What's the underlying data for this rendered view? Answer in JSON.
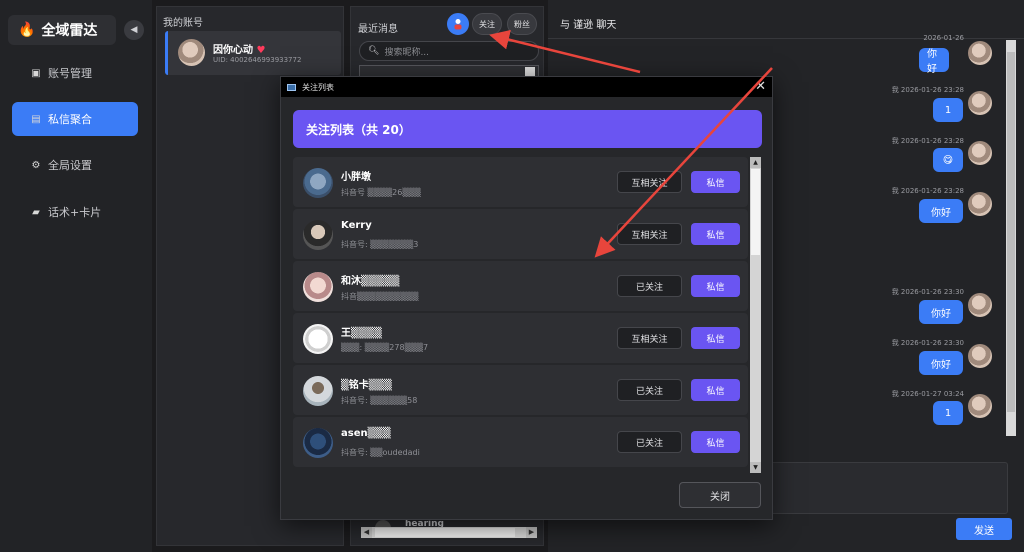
{
  "sidebar": {
    "logo": "全域雷达",
    "collapse_glyph": "◀",
    "items": [
      {
        "label": "账号管理",
        "icon": "id-card-icon",
        "glyph": "▣"
      },
      {
        "label": "私信聚合",
        "icon": "chat-bubble-icon",
        "glyph": "▤"
      },
      {
        "label": "全局设置",
        "icon": "gear-icon",
        "glyph": "⚙"
      },
      {
        "label": "话术+卡片",
        "icon": "folder-icon",
        "glyph": "▰"
      }
    ],
    "active_index": 1
  },
  "accounts": {
    "header": "我的账号",
    "card": {
      "name": "因你心动",
      "heart": "♥",
      "uid": "UID: 4002646993933772"
    }
  },
  "messages": {
    "header": "最近消息",
    "buttons": {
      "follow": "关注",
      "fans": "粉丝"
    },
    "search_placeholder": "搜索昵称...",
    "bottom_item": "hearing"
  },
  "chat": {
    "title": "与 谨逊 聊天",
    "entries": [
      {
        "meta": "2026-01-26",
        "text": "你好"
      },
      {
        "meta": "我  2026-01-26 23:28",
        "text": "1"
      },
      {
        "meta": "我  2026-01-26 23:28",
        "text": "😋"
      },
      {
        "meta": "我  2026-01-26 23:28",
        "text": "你好"
      },
      {
        "meta": "我  2026-01-26 23:30",
        "text": "你好"
      },
      {
        "meta": "我  2026-01-26 23:30",
        "text": "你好"
      },
      {
        "meta": "我  2026-01-27 03:24",
        "text": "1"
      }
    ],
    "send_label": "发送"
  },
  "modal": {
    "window_title": "关注列表",
    "close_glyph": "✕",
    "banner": "关注列表（共 20）",
    "rows": [
      {
        "name": "小胖墩",
        "sub": "抖音号 ▒▒▒▒26▒▒▒",
        "status": "互相关注",
        "dm": "私信"
      },
      {
        "name": "Kerry",
        "sub": "抖音号: ▒▒▒▒▒▒▒3",
        "status": "互相关注",
        "dm": "私信"
      },
      {
        "name": "和沐▒▒▒▒▒",
        "sub": "抖音▒▒▒▒▒▒▒▒▒▒",
        "status": "已关注",
        "dm": "私信"
      },
      {
        "name": "王▒▒▒▒",
        "sub": "▒▒▒: ▒▒▒▒278▒▒▒7",
        "status": "互相关注",
        "dm": "私信"
      },
      {
        "name": "▒铭卡▒▒▒",
        "sub": "抖音号: ▒▒▒▒▒▒58",
        "status": "已关注",
        "dm": "私信"
      },
      {
        "name": "asen▒▒▒",
        "sub": "抖音号: ▒▒oudedadi",
        "status": "已关注",
        "dm": "私信"
      }
    ],
    "close_label": "关闭"
  },
  "colors": {
    "accent_blue": "#3b7cf6",
    "accent_purple": "#6a55f2",
    "annotation_red": "#e8453c"
  }
}
